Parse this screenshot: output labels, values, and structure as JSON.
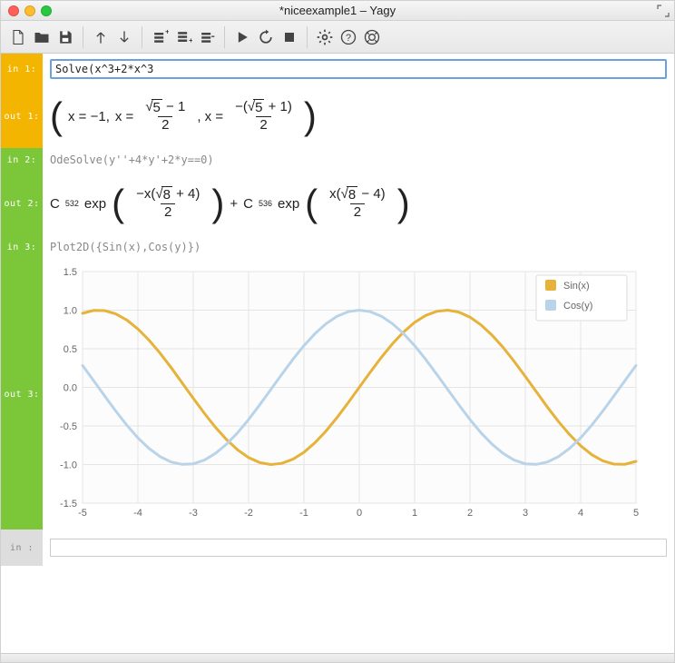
{
  "window_title": "*niceexample1 – Yagy",
  "cells": {
    "in1_label": "in  1:",
    "in1_value": "Solve(x^3+2*x^3",
    "out1_label": "out 1:",
    "in2_label": "in  2:",
    "in2_value": "OdeSolve(y''+4*y'+2*y==0)",
    "out2_label": "out 2:",
    "in3_label": "in  3:",
    "in3_value": "Plot2D({Sin(x),Cos(y)})",
    "out3_label": "out 3:",
    "in_blank_label": "in   :"
  },
  "math": {
    "out1": {
      "a": "x = −1,",
      "b_num_pre": "",
      "b_num_sqrt": "5",
      "b_num_post": " − 1",
      "b_den": "2",
      "b_pre": "x = ",
      "c_pre": ", x = ",
      "c_num_pre": "−(",
      "c_num_sqrt": "5",
      "c_num_post": " + 1)",
      "c_den": "2"
    },
    "out2": {
      "c1": "C",
      "c1sub": "532",
      "exp1": " exp",
      "a_num_pre": "−x(",
      "a_num_sqrt": "8",
      "a_num_post": " + 4)",
      "a_den": "2",
      "plus": " + ",
      "c2": "C",
      "c2sub": "536",
      "exp2": " exp",
      "b_num_pre": "x(",
      "b_num_sqrt": "8",
      "b_num_post": " − 4)",
      "b_den": "2"
    }
  },
  "chart_data": {
    "type": "line",
    "title": "",
    "xlabel": "",
    "ylabel": "",
    "xlim": [
      -5,
      5
    ],
    "ylim": [
      -1.5,
      1.5
    ],
    "yticks": [
      -1.5,
      -1.0,
      -0.5,
      0.0,
      0.5,
      1.0,
      1.5
    ],
    "xticks": [
      -5,
      -4,
      -3,
      -2,
      -1,
      0,
      1,
      2,
      3,
      4,
      5
    ],
    "series": [
      {
        "name": "Sin(x)",
        "color": "#e6b23a",
        "x": [
          -5,
          -4.8,
          -4.6,
          -4.4,
          -4.2,
          -4,
          -3.8,
          -3.6,
          -3.4,
          -3.2,
          -3,
          -2.8,
          -2.6,
          -2.4,
          -2.2,
          -2,
          -1.8,
          -1.6,
          -1.4,
          -1.2,
          -1,
          -0.8,
          -0.6,
          -0.4,
          -0.2,
          0,
          0.2,
          0.4,
          0.6,
          0.8,
          1,
          1.2,
          1.4,
          1.6,
          1.8,
          2,
          2.2,
          2.4,
          2.6,
          2.8,
          3,
          3.2,
          3.4,
          3.6,
          3.8,
          4,
          4.2,
          4.4,
          4.6,
          4.8,
          5
        ],
        "y": [
          0.959,
          0.996,
          0.994,
          0.952,
          0.872,
          0.757,
          0.612,
          0.443,
          0.256,
          0.058,
          -0.141,
          -0.335,
          -0.516,
          -0.675,
          -0.808,
          -0.909,
          -0.974,
          -0.9996,
          -0.985,
          -0.932,
          -0.841,
          -0.717,
          -0.565,
          -0.389,
          -0.199,
          0,
          0.199,
          0.389,
          0.565,
          0.717,
          0.841,
          0.932,
          0.985,
          0.9996,
          0.974,
          0.909,
          0.808,
          0.675,
          0.516,
          0.335,
          0.141,
          -0.058,
          -0.256,
          -0.443,
          -0.612,
          -0.757,
          -0.872,
          -0.952,
          -0.994,
          -0.996,
          -0.959
        ]
      },
      {
        "name": "Cos(y)",
        "color": "#b9d3e8",
        "x": [
          -5,
          -4.8,
          -4.6,
          -4.4,
          -4.2,
          -4,
          -3.8,
          -3.6,
          -3.4,
          -3.2,
          -3,
          -2.8,
          -2.6,
          -2.4,
          -2.2,
          -2,
          -1.8,
          -1.6,
          -1.4,
          -1.2,
          -1,
          -0.8,
          -0.6,
          -0.4,
          -0.2,
          0,
          0.2,
          0.4,
          0.6,
          0.8,
          1,
          1.2,
          1.4,
          1.6,
          1.8,
          2,
          2.2,
          2.4,
          2.6,
          2.8,
          3,
          3.2,
          3.4,
          3.6,
          3.8,
          4,
          4.2,
          4.4,
          4.6,
          4.8,
          5
        ],
        "y": [
          0.284,
          0.087,
          -0.112,
          -0.307,
          -0.49,
          -0.654,
          -0.79,
          -0.896,
          -0.967,
          -0.998,
          -0.99,
          -0.942,
          -0.857,
          -0.737,
          -0.589,
          -0.416,
          -0.227,
          -0.029,
          0.17,
          0.362,
          0.54,
          0.697,
          0.825,
          0.921,
          0.98,
          1,
          0.98,
          0.921,
          0.825,
          0.697,
          0.54,
          0.362,
          0.17,
          -0.029,
          -0.227,
          -0.416,
          -0.589,
          -0.737,
          -0.857,
          -0.942,
          -0.99,
          -0.998,
          -0.967,
          -0.896,
          -0.79,
          -0.654,
          -0.49,
          -0.307,
          -0.112,
          0.087,
          0.284
        ]
      }
    ]
  }
}
